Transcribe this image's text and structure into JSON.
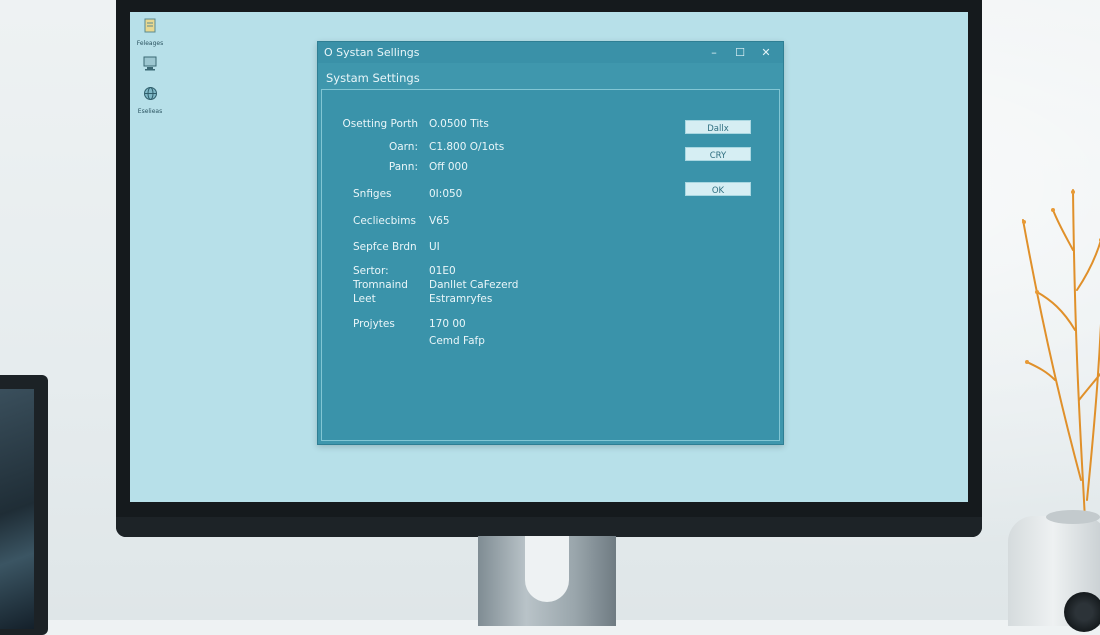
{
  "window": {
    "title": "O Systan Sellings",
    "header": "Systam Settings",
    "controls": {
      "minimize": "–",
      "maximize": "☐",
      "close": "✕"
    }
  },
  "desktop_icons": [
    {
      "label": "Feleages",
      "icon": "document-icon"
    },
    {
      "label": "",
      "icon": "computer-icon"
    },
    {
      "label": "Eselieas",
      "icon": "globe-icon"
    }
  ],
  "settings_rows": [
    {
      "label": "Osetting Porth",
      "value": "O.0500 Tits"
    },
    {
      "label": "Oarn:",
      "value": "C1.800 O/1ots"
    },
    {
      "label": "Pann:",
      "value": "Off 000"
    },
    {
      "label": "Snfiges",
      "value": "0I:050"
    },
    {
      "label": "Cecliecbims",
      "value": "V65"
    },
    {
      "label": "Sepfce Brdn",
      "value": "UI"
    },
    {
      "label": "Sertor:",
      "value": "01E0"
    },
    {
      "label": "Tromnaind",
      "value": "Danllet CaFezerd"
    },
    {
      "label": "Leet",
      "value": "Estramryfes"
    },
    {
      "label": "Projytes",
      "value": "170 00"
    },
    {
      "label": "",
      "value": "Cemd Fafp"
    }
  ],
  "buttons": [
    {
      "label": "Dallx"
    },
    {
      "label": "CRY"
    },
    {
      "label": "OK"
    }
  ],
  "colors": {
    "window_bg": "#3f97ad",
    "screen_bg": "#b7e0e9",
    "button_bg": "#d6eef3"
  }
}
